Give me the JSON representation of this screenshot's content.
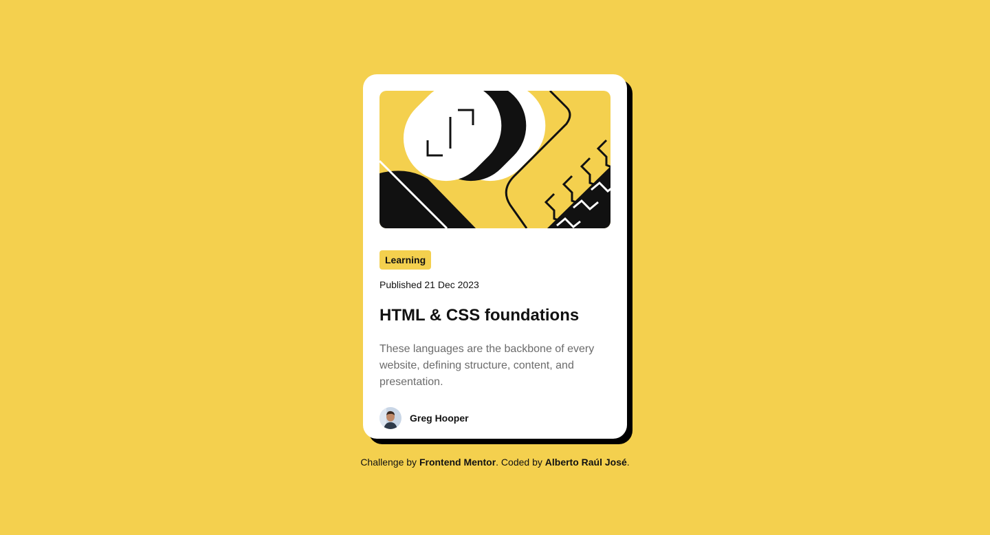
{
  "card": {
    "tag": "Learning",
    "published": "Published 21 Dec 2023",
    "title": "HTML & CSS foundations",
    "description": "These languages are the backbone of every website, defining structure, content, and presentation.",
    "author": "Greg Hooper"
  },
  "attribution": {
    "prefix": "Challenge by ",
    "challenge_link": "Frontend Mentor",
    "middle": ". Coded by ",
    "author_link": "Alberto Raúl José",
    "suffix": "."
  },
  "colors": {
    "background": "#f4d04e",
    "card": "#ffffff",
    "text": "#111111",
    "muted": "#6b6b6b",
    "shadow": "#000000"
  }
}
